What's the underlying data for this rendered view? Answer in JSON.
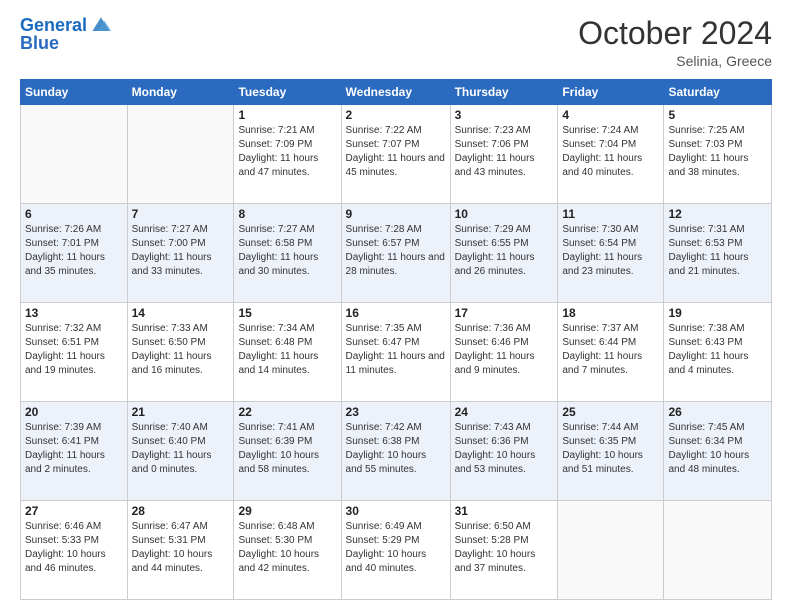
{
  "header": {
    "logo_line1": "General",
    "logo_line2": "Blue",
    "month": "October 2024",
    "location": "Selinia, Greece"
  },
  "days_of_week": [
    "Sunday",
    "Monday",
    "Tuesday",
    "Wednesday",
    "Thursday",
    "Friday",
    "Saturday"
  ],
  "weeks": [
    [
      {
        "day": "",
        "detail": ""
      },
      {
        "day": "",
        "detail": ""
      },
      {
        "day": "1",
        "detail": "Sunrise: 7:21 AM\nSunset: 7:09 PM\nDaylight: 11 hours and 47 minutes."
      },
      {
        "day": "2",
        "detail": "Sunrise: 7:22 AM\nSunset: 7:07 PM\nDaylight: 11 hours and 45 minutes."
      },
      {
        "day": "3",
        "detail": "Sunrise: 7:23 AM\nSunset: 7:06 PM\nDaylight: 11 hours and 43 minutes."
      },
      {
        "day": "4",
        "detail": "Sunrise: 7:24 AM\nSunset: 7:04 PM\nDaylight: 11 hours and 40 minutes."
      },
      {
        "day": "5",
        "detail": "Sunrise: 7:25 AM\nSunset: 7:03 PM\nDaylight: 11 hours and 38 minutes."
      }
    ],
    [
      {
        "day": "6",
        "detail": "Sunrise: 7:26 AM\nSunset: 7:01 PM\nDaylight: 11 hours and 35 minutes."
      },
      {
        "day": "7",
        "detail": "Sunrise: 7:27 AM\nSunset: 7:00 PM\nDaylight: 11 hours and 33 minutes."
      },
      {
        "day": "8",
        "detail": "Sunrise: 7:27 AM\nSunset: 6:58 PM\nDaylight: 11 hours and 30 minutes."
      },
      {
        "day": "9",
        "detail": "Sunrise: 7:28 AM\nSunset: 6:57 PM\nDaylight: 11 hours and 28 minutes."
      },
      {
        "day": "10",
        "detail": "Sunrise: 7:29 AM\nSunset: 6:55 PM\nDaylight: 11 hours and 26 minutes."
      },
      {
        "day": "11",
        "detail": "Sunrise: 7:30 AM\nSunset: 6:54 PM\nDaylight: 11 hours and 23 minutes."
      },
      {
        "day": "12",
        "detail": "Sunrise: 7:31 AM\nSunset: 6:53 PM\nDaylight: 11 hours and 21 minutes."
      }
    ],
    [
      {
        "day": "13",
        "detail": "Sunrise: 7:32 AM\nSunset: 6:51 PM\nDaylight: 11 hours and 19 minutes."
      },
      {
        "day": "14",
        "detail": "Sunrise: 7:33 AM\nSunset: 6:50 PM\nDaylight: 11 hours and 16 minutes."
      },
      {
        "day": "15",
        "detail": "Sunrise: 7:34 AM\nSunset: 6:48 PM\nDaylight: 11 hours and 14 minutes."
      },
      {
        "day": "16",
        "detail": "Sunrise: 7:35 AM\nSunset: 6:47 PM\nDaylight: 11 hours and 11 minutes."
      },
      {
        "day": "17",
        "detail": "Sunrise: 7:36 AM\nSunset: 6:46 PM\nDaylight: 11 hours and 9 minutes."
      },
      {
        "day": "18",
        "detail": "Sunrise: 7:37 AM\nSunset: 6:44 PM\nDaylight: 11 hours and 7 minutes."
      },
      {
        "day": "19",
        "detail": "Sunrise: 7:38 AM\nSunset: 6:43 PM\nDaylight: 11 hours and 4 minutes."
      }
    ],
    [
      {
        "day": "20",
        "detail": "Sunrise: 7:39 AM\nSunset: 6:41 PM\nDaylight: 11 hours and 2 minutes."
      },
      {
        "day": "21",
        "detail": "Sunrise: 7:40 AM\nSunset: 6:40 PM\nDaylight: 11 hours and 0 minutes."
      },
      {
        "day": "22",
        "detail": "Sunrise: 7:41 AM\nSunset: 6:39 PM\nDaylight: 10 hours and 58 minutes."
      },
      {
        "day": "23",
        "detail": "Sunrise: 7:42 AM\nSunset: 6:38 PM\nDaylight: 10 hours and 55 minutes."
      },
      {
        "day": "24",
        "detail": "Sunrise: 7:43 AM\nSunset: 6:36 PM\nDaylight: 10 hours and 53 minutes."
      },
      {
        "day": "25",
        "detail": "Sunrise: 7:44 AM\nSunset: 6:35 PM\nDaylight: 10 hours and 51 minutes."
      },
      {
        "day": "26",
        "detail": "Sunrise: 7:45 AM\nSunset: 6:34 PM\nDaylight: 10 hours and 48 minutes."
      }
    ],
    [
      {
        "day": "27",
        "detail": "Sunrise: 6:46 AM\nSunset: 5:33 PM\nDaylight: 10 hours and 46 minutes."
      },
      {
        "day": "28",
        "detail": "Sunrise: 6:47 AM\nSunset: 5:31 PM\nDaylight: 10 hours and 44 minutes."
      },
      {
        "day": "29",
        "detail": "Sunrise: 6:48 AM\nSunset: 5:30 PM\nDaylight: 10 hours and 42 minutes."
      },
      {
        "day": "30",
        "detail": "Sunrise: 6:49 AM\nSunset: 5:29 PM\nDaylight: 10 hours and 40 minutes."
      },
      {
        "day": "31",
        "detail": "Sunrise: 6:50 AM\nSunset: 5:28 PM\nDaylight: 10 hours and 37 minutes."
      },
      {
        "day": "",
        "detail": ""
      },
      {
        "day": "",
        "detail": ""
      }
    ]
  ]
}
